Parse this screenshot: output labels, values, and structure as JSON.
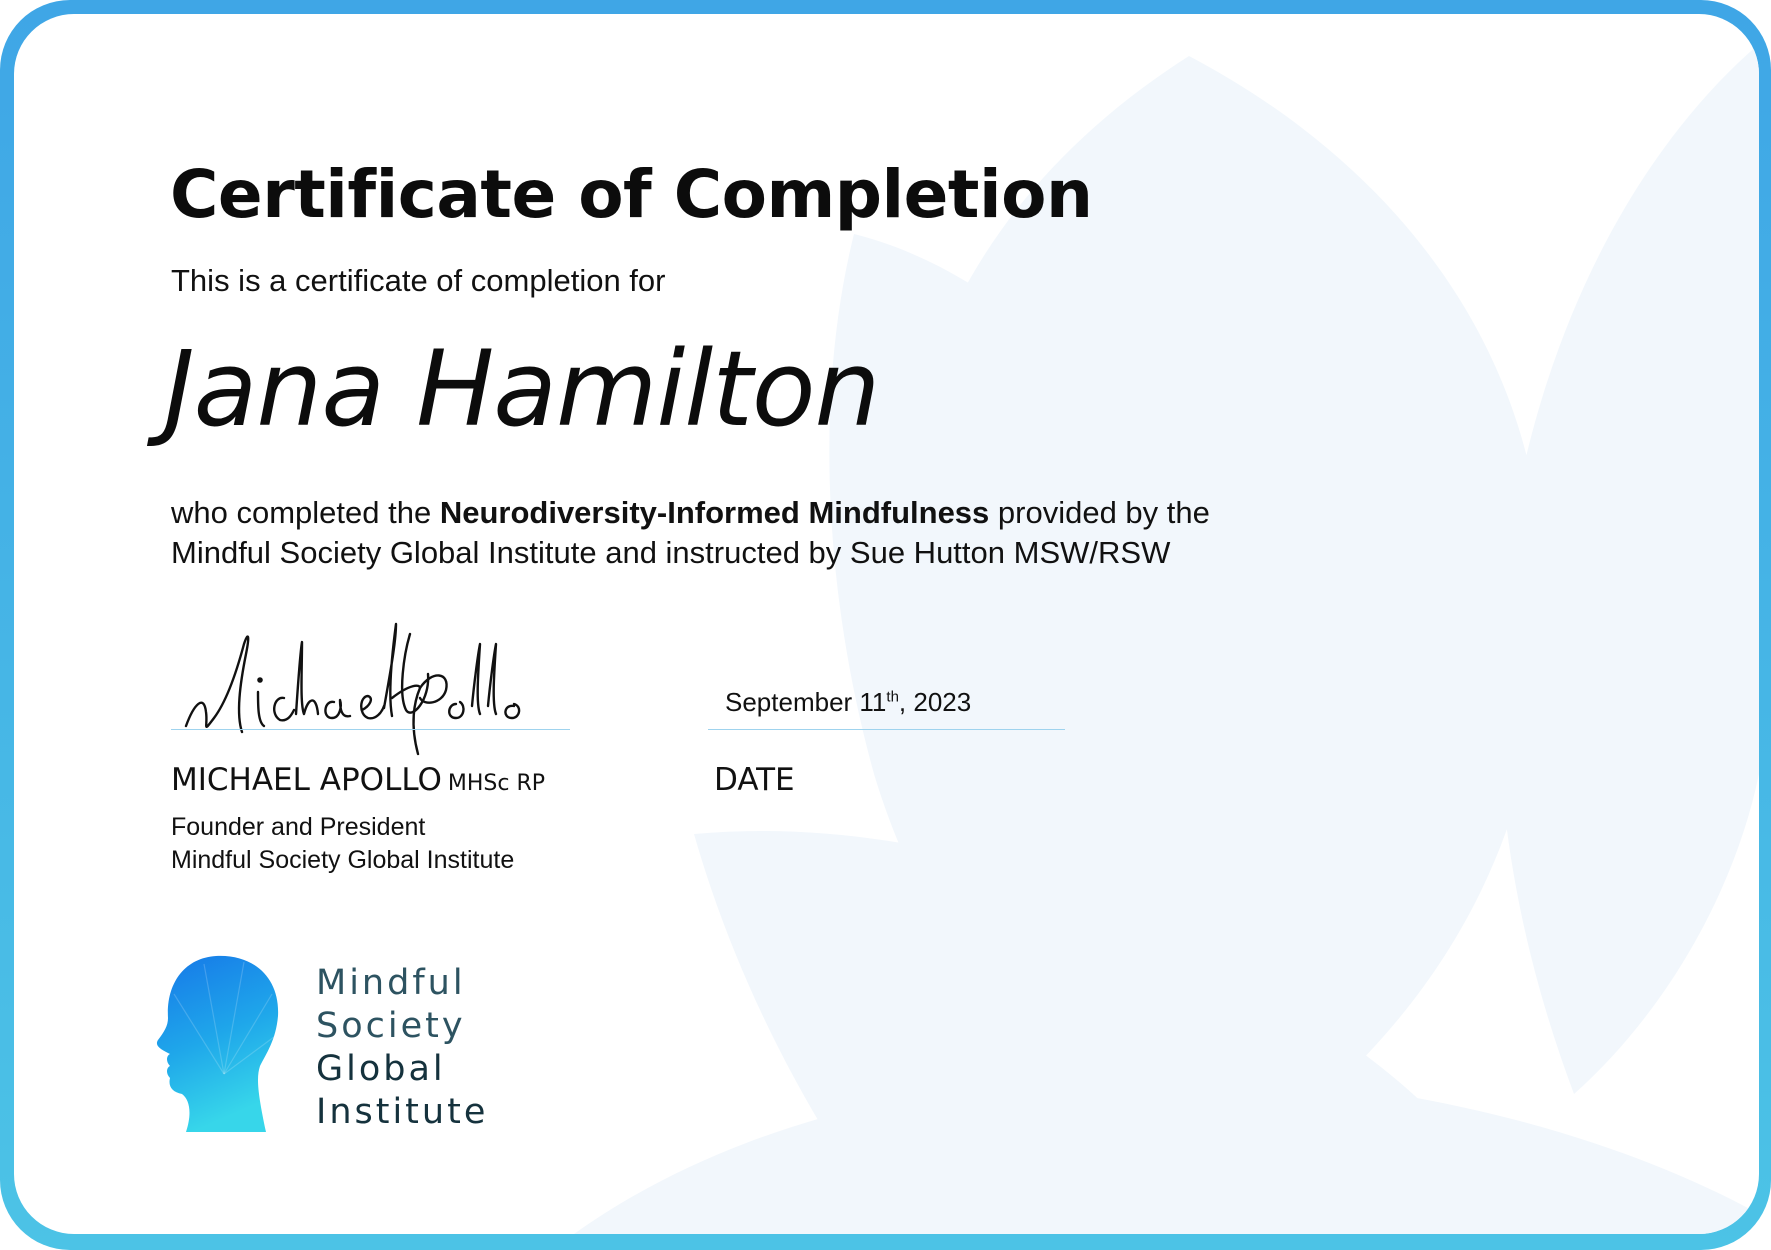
{
  "certificate": {
    "title": "Certificate of Completion",
    "intro": "This is a certificate of completion for",
    "recipient": "Jana Hamilton",
    "body": {
      "prefix": "who completed the ",
      "course": "Neurodiversity-Informed Mindfulness",
      "suffix_line1": " provided by the",
      "line2": "Mindful Society Global Institute and instructed by Sue Hutton MSW/RSW"
    },
    "signature_text": "Michael Apollo",
    "signer": {
      "name": "MICHAEL APOLLO",
      "credentials": "MHSc RP",
      "role": "Founder and President",
      "organization": "Mindful Society Global Institute"
    },
    "date": {
      "month_day": "September 11",
      "ordinal": "th",
      "year": ", 2023",
      "label": "DATE"
    }
  },
  "logo": {
    "line1": "Mindful",
    "line2": "Society",
    "line3": "Global",
    "line4": "Institute"
  },
  "colors": {
    "border_top": "#3fa6e6",
    "border_bottom": "#4cc3e6",
    "rule": "#9fd3ee",
    "logo_text": "#2d5361",
    "petal": "#eef5fb"
  }
}
